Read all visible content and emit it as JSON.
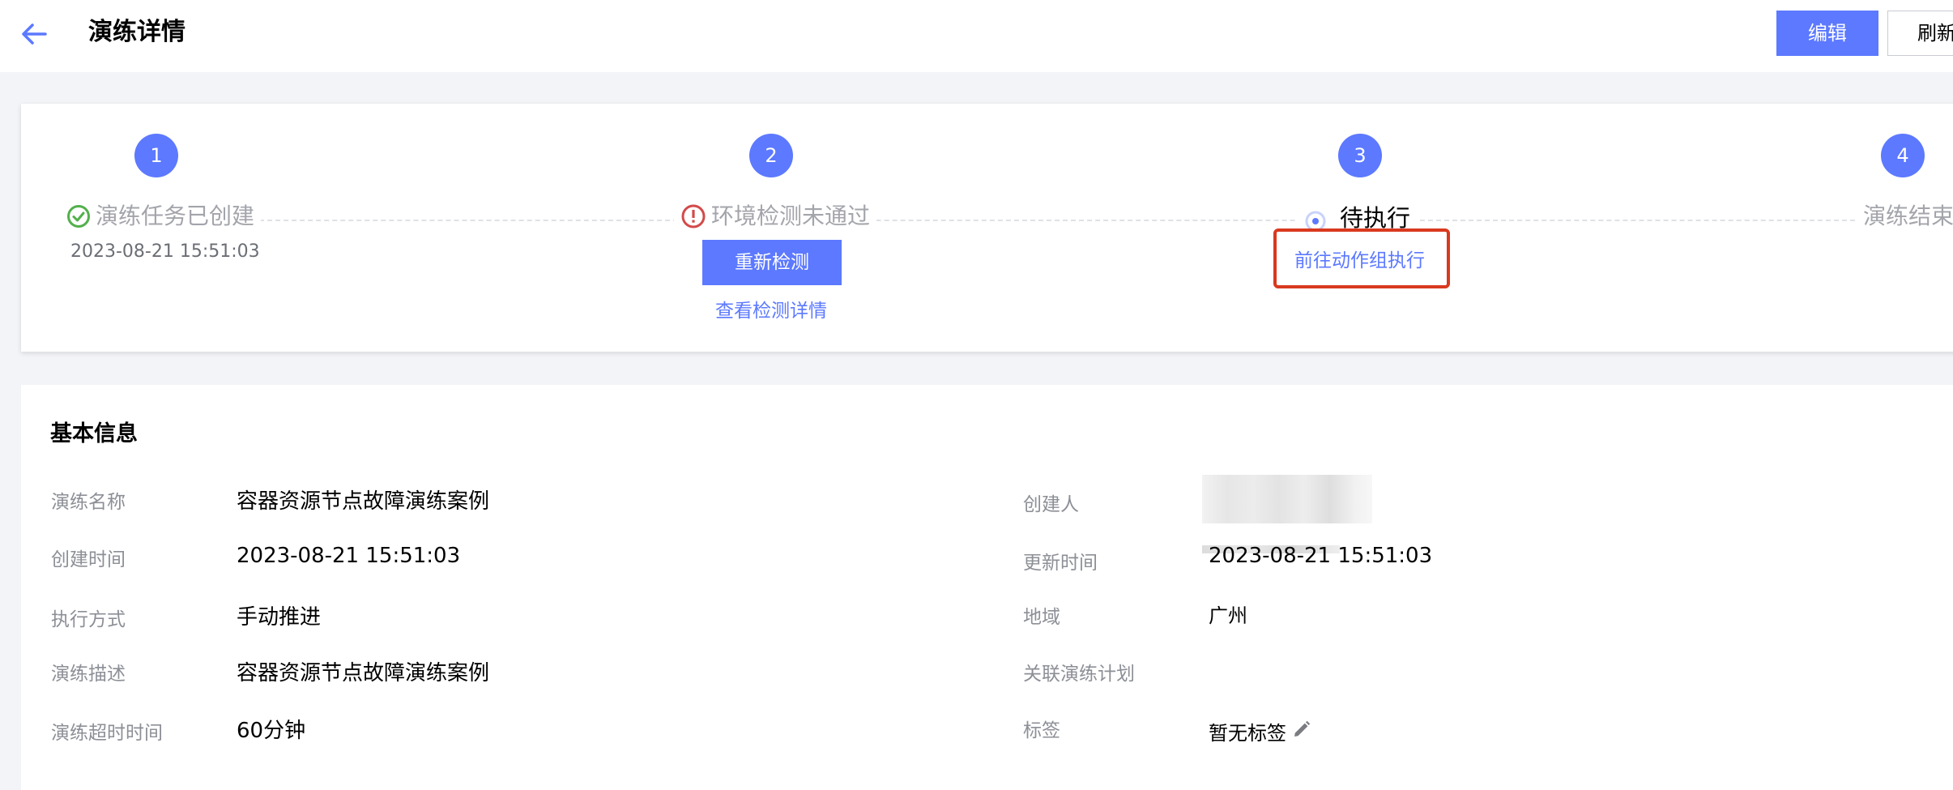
{
  "header": {
    "title": "演练详情",
    "edit_label": "编辑",
    "refresh_label": "刷新"
  },
  "steps": [
    {
      "number": "1",
      "title": "演练任务已创建",
      "time": "2023-08-21 15:51:03",
      "status": "done"
    },
    {
      "number": "2",
      "title": "环境检测未通过",
      "status": "error",
      "button": "重新检测",
      "link": "查看检测详情"
    },
    {
      "number": "3",
      "title": "待执行",
      "status": "active",
      "link": "前往动作组执行"
    },
    {
      "number": "4",
      "title": "演练结束",
      "status": "pending"
    }
  ],
  "basic_info": {
    "title": "基本信息",
    "left": [
      {
        "label": "演练名称",
        "value": "容器资源节点故障演练案例"
      },
      {
        "label": "创建时间",
        "value": "2023-08-21 15:51:03"
      },
      {
        "label": "执行方式",
        "value": "手动推进"
      },
      {
        "label": "演练描述",
        "value": "容器资源节点故障演练案例"
      },
      {
        "label": "演练超时时间",
        "value": "60分钟"
      }
    ],
    "right": [
      {
        "label": "创建人",
        "value": ""
      },
      {
        "label": "更新时间",
        "value": "2023-08-21 15:51:03"
      },
      {
        "label": "地域",
        "value": "广州"
      },
      {
        "label": "关联演练计划",
        "value": ""
      },
      {
        "label": "标签",
        "value": "暂无标签"
      }
    ]
  },
  "colors": {
    "primary": "#5c79ff",
    "success": "#52b04b",
    "error": "#d34a4a",
    "highlight": "#d9391f"
  }
}
